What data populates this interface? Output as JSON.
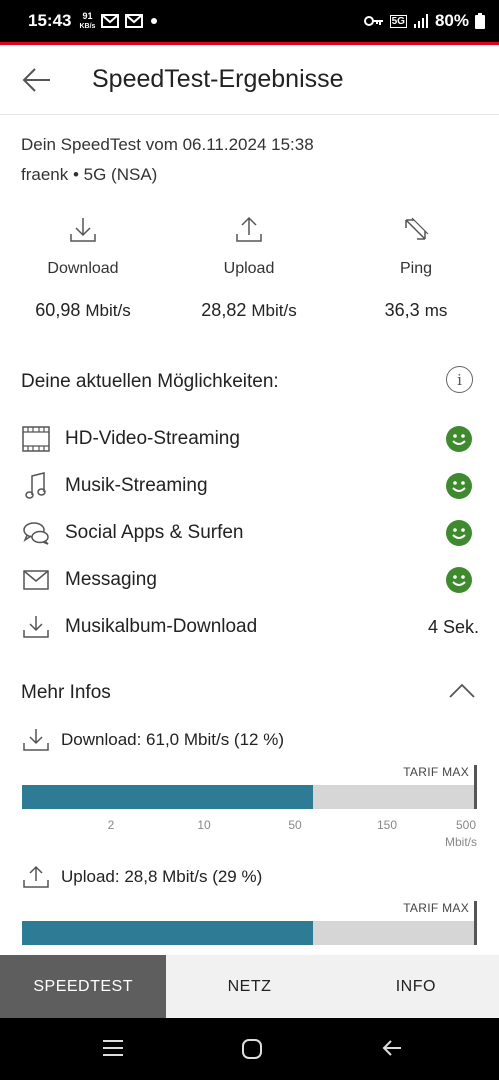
{
  "status_bar": {
    "time": "15:43",
    "kbs_value": "91",
    "kbs_unit": "KB/s",
    "network": "5G",
    "battery": "80%"
  },
  "header": {
    "title": "SpeedTest-Ergebnisse"
  },
  "test": {
    "date_line": "Dein SpeedTest vom 06.11.2024 15:38",
    "network_line": "fraenk • 5G (NSA)"
  },
  "metrics": {
    "download": {
      "label": "Download",
      "value": "60,98",
      "unit": "Mbit/s",
      "icon": "download-icon"
    },
    "upload": {
      "label": "Upload",
      "value": "28,82",
      "unit": "Mbit/s",
      "icon": "upload-icon"
    },
    "ping": {
      "label": "Ping",
      "value": "36,3",
      "unit": "ms",
      "icon": "ping-arrows-icon"
    }
  },
  "capabilities": {
    "title": "Deine aktuellen Möglichkeiten:",
    "items": [
      {
        "label": "HD-Video-Streaming",
        "icon": "film-icon",
        "result": "smiley",
        "value": ""
      },
      {
        "label": "Musik-Streaming",
        "icon": "music-note-icon",
        "result": "smiley",
        "value": ""
      },
      {
        "label": "Social Apps & Surfen",
        "icon": "chat-bubbles-icon",
        "result": "smiley",
        "value": ""
      },
      {
        "label": "Messaging",
        "icon": "envelope-icon",
        "result": "smiley",
        "value": ""
      },
      {
        "label": "Musikalbum-Download",
        "icon": "download-icon",
        "result": "text",
        "value": "4 Sek."
      }
    ]
  },
  "more_info": {
    "title": "Mehr Infos",
    "download": {
      "label": "Download: 61,0 Mbit/s (12 %)",
      "tarif": "TARIF MAX",
      "fill": 0.64,
      "ticks": [
        "2",
        "10",
        "50",
        "150",
        "500"
      ],
      "unit": "Mbit/s"
    },
    "upload": {
      "label": "Upload: 28,8 Mbit/s (29 %)",
      "tarif": "TARIF MAX",
      "fill": 0.64
    }
  },
  "tabs": [
    {
      "label": "SPEEDTEST",
      "active": true
    },
    {
      "label": "NETZ",
      "active": false
    },
    {
      "label": "INFO",
      "active": false
    }
  ],
  "colors": {
    "accent_red": "#e2001a",
    "bar_fill": "#2d7b94",
    "smiley_green": "#3f8a2f",
    "tab_active": "#5e5e5e"
  }
}
